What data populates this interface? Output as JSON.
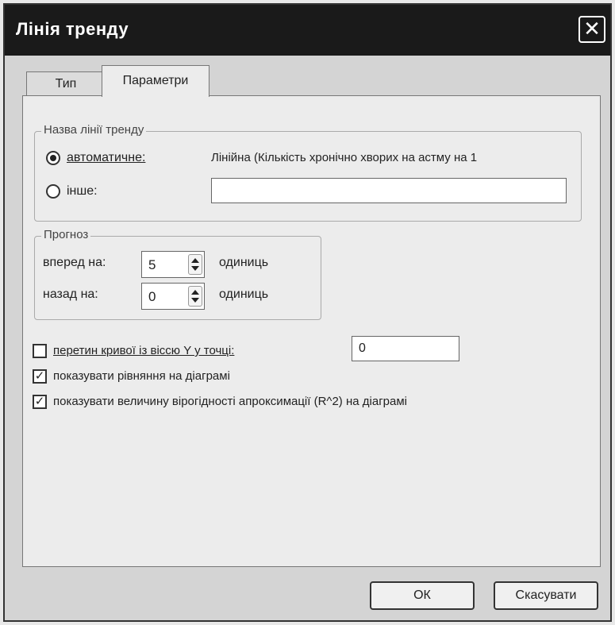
{
  "window": {
    "title": "Лінія тренду"
  },
  "tabs": [
    {
      "label": "Тип",
      "active": false
    },
    {
      "label": "Параметри",
      "active": true
    }
  ],
  "trendline_name": {
    "legend": "Назва лінії тренду",
    "automatic_label": "автоматичне:",
    "automatic_value": "Лінійна (Кількість хронічно хворих на астму на 1",
    "custom_label": "інше:",
    "custom_value": "",
    "selected": "automatic"
  },
  "forecast": {
    "legend": "Прогноз",
    "forward_label": "вперед на:",
    "forward_value": "5",
    "backward_label": "назад на:",
    "backward_value": "0",
    "units": "одиниць"
  },
  "options": {
    "intercept_label": "перетин кривої із віссю Y у точці:",
    "intercept_checked": false,
    "intercept_value": "0",
    "show_equation_label": "показувати рівняння на діаграмі",
    "show_equation_checked": true,
    "show_r2_label": "показувати величину вірогідності апроксимації (R^2) на діаграмі",
    "show_r2_checked": true
  },
  "buttons": {
    "ok": "ОК",
    "cancel": "Скасувати"
  }
}
